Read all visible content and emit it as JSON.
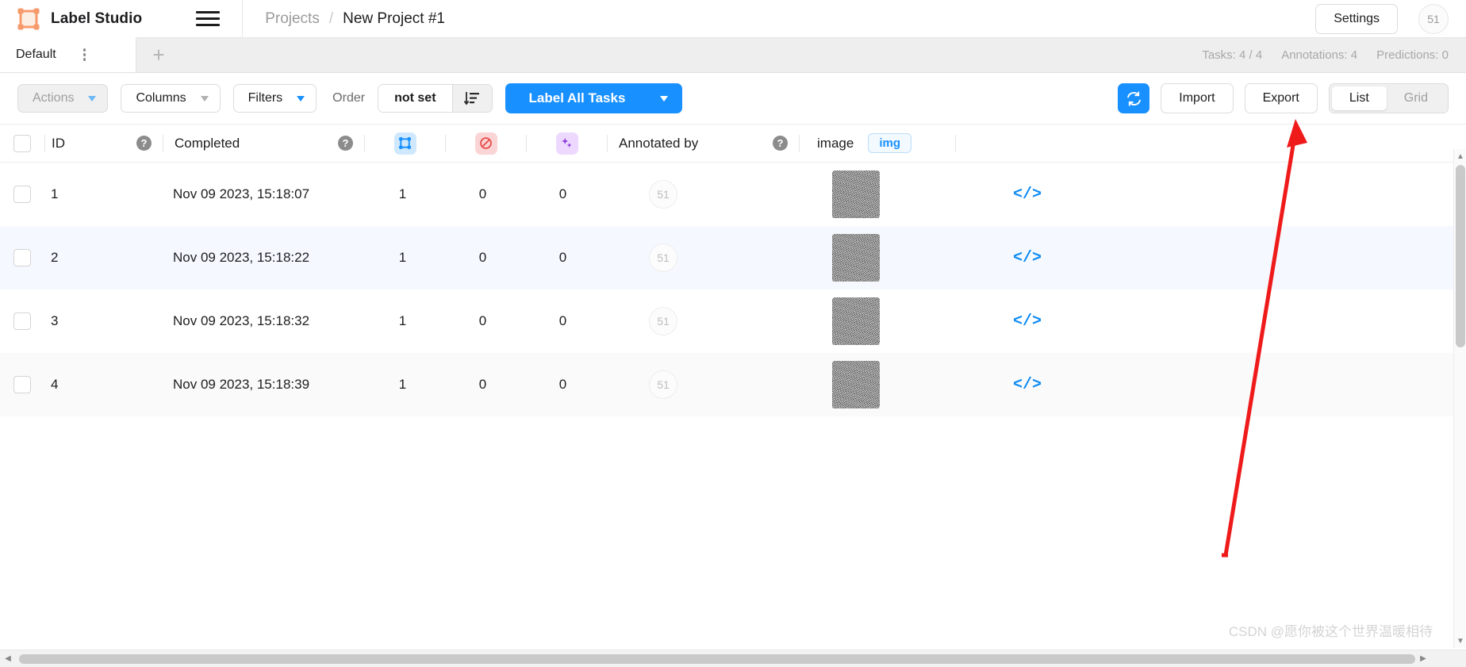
{
  "header": {
    "brand": "Label Studio",
    "logo_icon": "label-studio-logo-icon",
    "menu_icon": "hamburger-menu-icon",
    "breadcrumb": {
      "root": "Projects",
      "separator": "/",
      "current": "New Project #1"
    },
    "settings_label": "Settings",
    "user_badge": "51"
  },
  "tabbar": {
    "tabs": [
      {
        "label": "Default",
        "menu_icon": "tab-kebab-menu-icon"
      }
    ],
    "add_label": "+",
    "stats": [
      {
        "label": "Tasks: 4 / 4"
      },
      {
        "label": "Annotations: 4"
      },
      {
        "label": "Predictions: 0"
      }
    ]
  },
  "toolbar": {
    "actions_label": "Actions",
    "columns_label": "Columns",
    "filters_label": "Filters",
    "order_label": "Order",
    "order_value": "not set",
    "sort_icon": "sort-descending-icon",
    "label_all_label": "Label All Tasks",
    "refresh_icon": "refresh-icon",
    "import_label": "Import",
    "export_label": "Export",
    "view_list_label": "List",
    "view_grid_label": "Grid",
    "view_selected": "List"
  },
  "table": {
    "columns": {
      "id": "ID",
      "completed": "Completed",
      "annotations_icon": "annotations-count-icon",
      "cancelled_icon": "cancelled-annotations-icon",
      "predictions_icon": "predictions-sparkle-icon",
      "annotated_by": "Annotated by",
      "image": "image",
      "image_type_badge": "img",
      "help_icon": "help-question-icon",
      "code_icon": "code-view-icon"
    },
    "rows": [
      {
        "id": "1",
        "completed": "Nov 09 2023, 15:18:07",
        "annotations": "1",
        "cancelled": "0",
        "predictions": "0",
        "annotator": "51"
      },
      {
        "id": "2",
        "completed": "Nov 09 2023, 15:18:22",
        "annotations": "1",
        "cancelled": "0",
        "predictions": "0",
        "annotator": "51"
      },
      {
        "id": "3",
        "completed": "Nov 09 2023, 15:18:32",
        "annotations": "1",
        "cancelled": "0",
        "predictions": "0",
        "annotator": "51"
      },
      {
        "id": "4",
        "completed": "Nov 09 2023, 15:18:39",
        "annotations": "1",
        "cancelled": "0",
        "predictions": "0",
        "annotator": "51"
      }
    ]
  },
  "annotation": {
    "arrow_icon": "red-pointer-arrow",
    "color": "#ef1b1b"
  },
  "watermark": "CSDN @愿你被这个世界温暖相待",
  "colors": {
    "accent": "#1890ff",
    "brand": "#f79a6b",
    "row_highlight": "#f5f9ff"
  }
}
